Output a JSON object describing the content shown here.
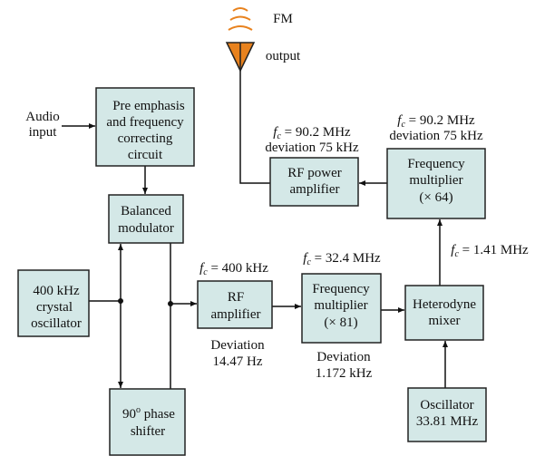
{
  "colors": {
    "block_fill": "#d4e8e7",
    "antenna": "#e8821e",
    "line": "#111111"
  },
  "antenna": {
    "label_line1": "FM",
    "label_line2": "output",
    "icon": "antenna-icon"
  },
  "audio_input": {
    "line1": "Audio",
    "line2": "input"
  },
  "blocks": {
    "pre_emphasis": [
      "Pre emphasis",
      "and frequency",
      "correcting",
      "circuit"
    ],
    "balanced_modulator": [
      "Balanced",
      "modulator"
    ],
    "crystal_oscillator": [
      "400 kHz",
      "crystal",
      "oscillator"
    ],
    "phase_shifter": [
      "90",
      "o",
      " phase",
      "shifter"
    ],
    "rf_amplifier": [
      "RF",
      "amplifier"
    ],
    "freq_mult_81": [
      "Frequency",
      "multiplier",
      "(× 81)"
    ],
    "heterodyne_mixer": [
      "Heterodyne",
      "mixer"
    ],
    "oscillator": [
      "Oscillator",
      "33.81 MHz"
    ],
    "freq_mult_64": [
      "Frequency",
      "multiplier",
      "(× 64)"
    ],
    "rf_power_amplifier": [
      "RF power",
      "amplifier"
    ]
  },
  "labels": {
    "fc_symbol": "f",
    "fc_sub": "c",
    "rf_amp_fc": " = 400 kHz",
    "rf_amp_dev": [
      "Deviation",
      "14.47 Hz"
    ],
    "mult81_fc": " = 32.4 MHz",
    "mult81_dev": [
      "Deviation",
      "1.172 kHz"
    ],
    "mixer_out_fc": " = 1.41 MHz",
    "mult64_fc": " = 90.2 MHz",
    "mult64_dev": "deviation 75 kHz",
    "power_amp_fc": " = 90.2 MHz",
    "power_amp_dev": "deviation 75 kHz"
  }
}
